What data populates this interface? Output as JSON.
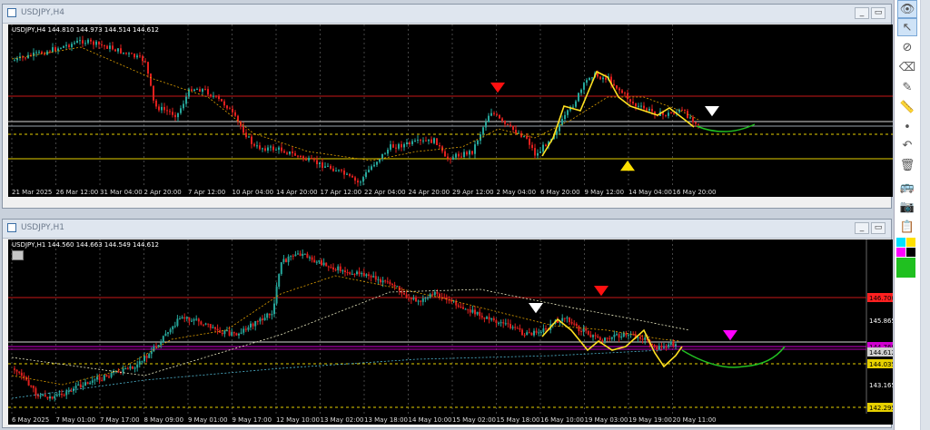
{
  "window1": {
    "title": "USDJPY,H4",
    "info": "USDJPY,H4  144.810 144.973 144.514 144.612",
    "time_labels": [
      "21 Mar 2025",
      "26 Mar 12:00",
      "31 Mar 04:00",
      "2 Apr 20:00",
      "7 Apr 12:00",
      "10 Apr 04:00",
      "14 Apr 20:00",
      "17 Apr 12:00",
      "22 Apr 04:00",
      "24 Apr 20:00",
      "29 Apr 12:00",
      "2 May 04:00",
      "6 May 20:00",
      "9 May 12:00",
      "14 May 04:00",
      "16 May 20:00"
    ]
  },
  "window2": {
    "title": "USDJPY,H1",
    "info": "USDJPY,H1  144.560 144.663 144.549 144.612",
    "time_labels": [
      "6 May 2025",
      "7 May 01:00",
      "7 May 17:00",
      "8 May 09:00",
      "9 May 01:00",
      "9 May 17:00",
      "12 May 10:00",
      "13 May 02:00",
      "13 May 18:00",
      "14 May 10:00",
      "15 May 02:00",
      "15 May 18:00",
      "16 May 10:00",
      "19 May 03:00",
      "19 May 19:00",
      "20 May 11:00"
    ],
    "price_labels": [
      {
        "text": "146.700",
        "color": "#ff2020"
      },
      {
        "text": "145.865",
        "color": "#ffffff"
      },
      {
        "text": "144.769",
        "color": "#d000d0"
      },
      {
        "text": "144.612",
        "color": "#d0d0d0"
      },
      {
        "text": "144.035",
        "color": "#e6d000"
      },
      {
        "text": "143.165",
        "color": "#ffffff"
      },
      {
        "text": "142.295",
        "color": "#e6d000"
      }
    ]
  },
  "colors": {
    "bull": "#26a69a",
    "bear": "#e0201e",
    "red_level": "#c81818",
    "yellow_level": "#e6d000",
    "white_level": "#d8d8d8",
    "magenta_level": "#d000d0",
    "projection": "#22c022",
    "pattern": "#ffe020"
  },
  "toolbar": {
    "icons": [
      "eye-icon",
      "cursor-icon",
      "no-symbol-icon",
      "eraser-icon",
      "pencil-icon",
      "ruler-icon",
      "dot-icon",
      "undo-icon",
      "trash-icon",
      "bus-icon",
      "camera-icon",
      "clipboard-icon"
    ],
    "swatches": [
      "#00e0ff",
      "#ff00ff",
      "#ffe000",
      "#000000",
      "#20c020",
      "#20c020"
    ]
  }
}
